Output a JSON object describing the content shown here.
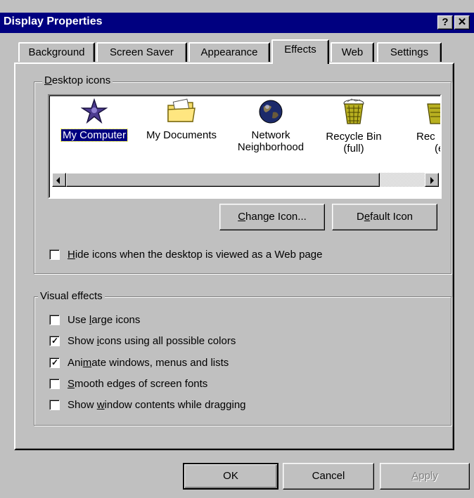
{
  "window": {
    "title": "Display Properties",
    "help_glyph": "?",
    "close_glyph": "✕"
  },
  "tabs": [
    {
      "label": "Background",
      "active": false
    },
    {
      "label": "Screen Saver",
      "active": false
    },
    {
      "label": "Appearance",
      "active": false
    },
    {
      "label": "Effects",
      "active": true
    },
    {
      "label": "Web",
      "active": false
    },
    {
      "label": "Settings",
      "active": false
    }
  ],
  "desktop_icons": {
    "group_label_key": "D",
    "group_label_rest": "esktop icons",
    "items": [
      {
        "label_line1": "My Computer",
        "label_line2": "",
        "icon": "my-computer-icon",
        "selected": true
      },
      {
        "label_line1": "My Documents",
        "label_line2": "",
        "icon": "folder-icon",
        "selected": false
      },
      {
        "label_line1": "Network",
        "label_line2": "Neighborhood",
        "icon": "network-globe-icon",
        "selected": false
      },
      {
        "label_line1": "Recycle Bin",
        "label_line2": "(full)",
        "icon": "recycle-bin-full-icon",
        "selected": false
      },
      {
        "label_line1": "Rec",
        "label_line2": "(e",
        "icon": "recycle-bin-empty-icon",
        "selected": false
      }
    ],
    "change_icon_key": "C",
    "change_icon_rest": "hange Icon...",
    "default_icon_pre": "D",
    "default_icon_key": "e",
    "default_icon_rest": "fault Icon",
    "hide_icons_key": "H",
    "hide_icons_rest": "ide icons when the desktop is viewed as a Web page",
    "hide_icons_checked": false
  },
  "visual_effects": {
    "group_label": "Visual effects",
    "options": [
      {
        "pre": "Use ",
        "key": "l",
        "post": "arge icons",
        "checked": false
      },
      {
        "pre": "Show ",
        "key": "i",
        "post": "cons using all possible colors",
        "checked": true
      },
      {
        "pre": "Ani",
        "key": "m",
        "post": "ate windows, menus and lists",
        "checked": true
      },
      {
        "pre": "",
        "key": "S",
        "post": "mooth edges of screen fonts",
        "checked": false
      },
      {
        "pre": "Show ",
        "key": "w",
        "post": "indow contents while dragging",
        "checked": false
      }
    ]
  },
  "footer": {
    "ok": "OK",
    "cancel": "Cancel",
    "apply_key": "A",
    "apply_rest": "pply"
  },
  "colors": {
    "face": "#c0c0c0",
    "title_bar": "#000080",
    "selection": "#000080"
  }
}
